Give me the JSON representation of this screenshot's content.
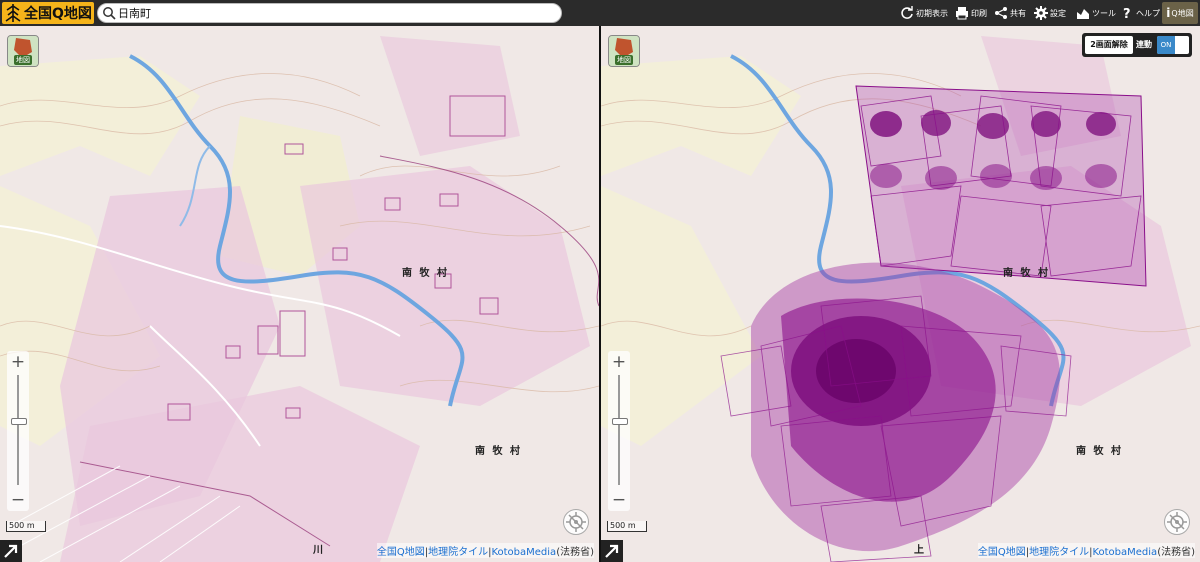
{
  "header": {
    "logo_text": "全国Q地図",
    "search_value": "日南町",
    "toolbar": [
      {
        "icon": "reset-icon",
        "label": "初期表示"
      },
      {
        "icon": "print-icon",
        "label": "印刷"
      },
      {
        "icon": "share-icon",
        "label": "共有"
      },
      {
        "icon": "gear-icon",
        "label": "設定"
      },
      {
        "icon": "tool-icon",
        "label": "ツール"
      },
      {
        "icon": "help-icon",
        "label": "ヘルプ"
      }
    ],
    "info_button_label": "Q地図"
  },
  "map": {
    "layer_button_label": "地図",
    "zoom_in": "+",
    "zoom_out": "−",
    "scale_label": "500 m",
    "place_labels": [
      "南 牧 村",
      "南 牧 村",
      "川",
      "上"
    ],
    "attribution": {
      "source1": "全国Q地図",
      "source2": "地理院タイル",
      "source3": "KotobaMedia",
      "license": "(法務省)"
    },
    "twin_panel": {
      "release_label": "2画面解除",
      "link_label": "連動",
      "toggle_state": "ON"
    }
  },
  "colors": {
    "topbar": "#2b2b2b",
    "logo_bg": "#f5b41a",
    "map_bg": "#f0e8e6",
    "parcel_fill": "#e9c8dd",
    "parcel_stroke": "#b0559a",
    "dense_parcels": "#8a0f8a",
    "river": "#6ea6e0",
    "toggle_on": "#3a89c9"
  }
}
